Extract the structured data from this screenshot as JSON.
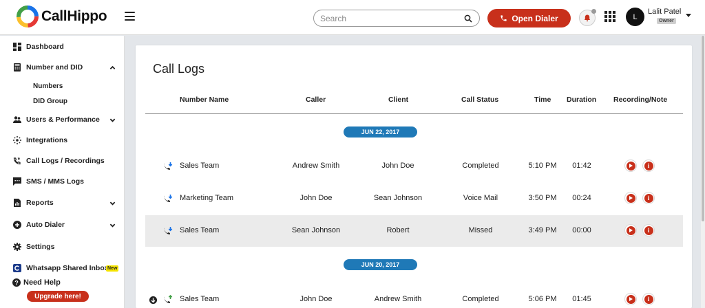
{
  "app": {
    "name": "CallHippo"
  },
  "header": {
    "search_placeholder": "Search",
    "dialer_label": "Open Dialer",
    "user": {
      "initial": "L",
      "name": "Lalit Patel",
      "role": "Owner"
    }
  },
  "sidebar": {
    "items": [
      {
        "label": "Dashboard",
        "icon": "dashboard-icon"
      },
      {
        "label": "Number and DID",
        "icon": "phone-keypad-icon",
        "expanded": true
      },
      {
        "label": "Users & Performance",
        "icon": "users-icon"
      },
      {
        "label": "Integrations",
        "icon": "integrations-icon"
      },
      {
        "label": "Call Logs / Recordings",
        "icon": "call-logs-icon"
      },
      {
        "label": "SMS / MMS Logs",
        "icon": "sms-icon"
      },
      {
        "label": "Reports",
        "icon": "reports-icon"
      },
      {
        "label": "Auto Dialer",
        "icon": "auto-dialer-icon"
      },
      {
        "label": "Settings",
        "icon": "gear-icon"
      },
      {
        "label": "Whatsapp Shared Inbox",
        "icon": "whatsapp-icon",
        "badge": "New"
      }
    ],
    "sub_items": [
      "Numbers",
      "DID Group"
    ],
    "help_label": "Need Help",
    "upgrade_label": "Upgrade here!"
  },
  "main": {
    "title": "Call Logs",
    "columns": [
      "Number Name",
      "Caller",
      "Client",
      "Call Status",
      "Time",
      "Duration",
      "Recording/Note"
    ],
    "groups": [
      {
        "date": "JUN 22, 2017",
        "rows": [
          {
            "number_name": "Sales Team",
            "caller": "Andrew Smith",
            "client": "John Doe",
            "status": "Completed",
            "time": "5:10 PM",
            "duration": "01:42"
          },
          {
            "number_name": "Marketing Team",
            "caller": "John Doe",
            "client": "Sean Johnson",
            "status": "Voice Mail",
            "time": "3:50 PM",
            "duration": "00:24"
          },
          {
            "number_name": "Sales Team",
            "caller": "Sean Johnson",
            "client": "Robert",
            "status": "Missed",
            "time": "3:49 PM",
            "duration": "00:00"
          }
        ]
      },
      {
        "date": "JUN 20, 2017",
        "rows": [
          {
            "number_name": "Sales Team",
            "caller": "John Doe",
            "client": "Andrew Smith",
            "status": "Completed",
            "time": "5:06 PM",
            "duration": "01:45"
          }
        ]
      }
    ]
  },
  "colors": {
    "accent": "#c8301b",
    "date_badge": "#1f79b7",
    "highlight_row": "#ebebeb"
  }
}
